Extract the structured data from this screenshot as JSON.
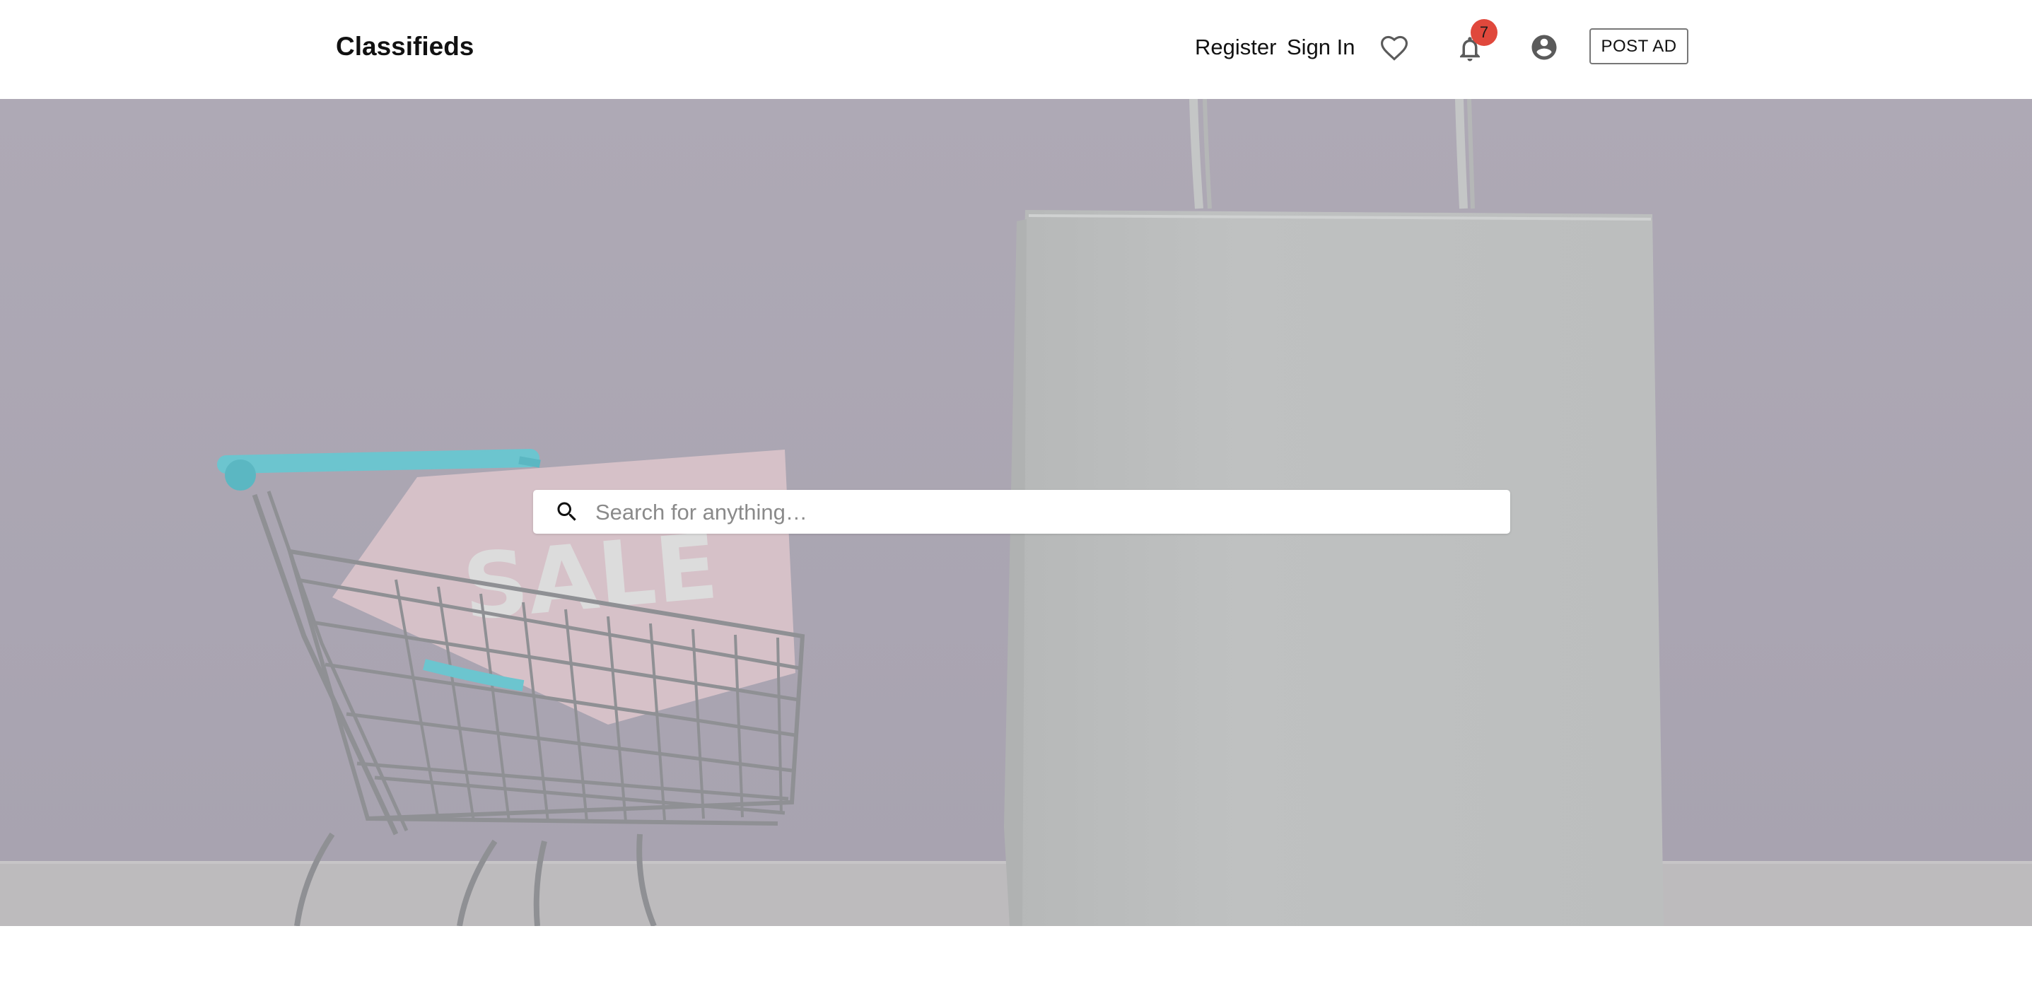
{
  "header": {
    "brand": "Classifieds",
    "nav": {
      "register": "Register",
      "sign_in": "Sign In"
    },
    "icons": {
      "favorites": "heart-outline-icon",
      "notifications": "bell-icon",
      "account": "account-circle-icon"
    },
    "notification_count": "7",
    "post_ad_label": "POST AD"
  },
  "hero": {
    "background": "shopping-cart-and-paper-bag-photo",
    "sign_text": "SALE",
    "search": {
      "placeholder": "Search for anything…",
      "value": "",
      "icon": "search-icon"
    }
  },
  "colors": {
    "hero_backdrop": "#aca7b3",
    "badge": "#e0483c",
    "cart_handle": "#6cc5cf",
    "sale_sign": "#d7c2c8"
  }
}
